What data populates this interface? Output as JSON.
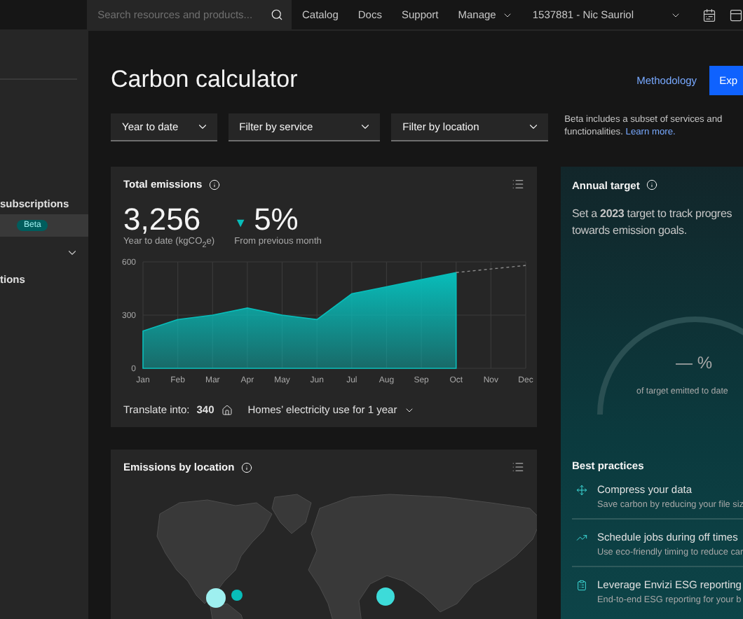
{
  "header": {
    "search": {
      "placeholder": "Search resources and products..."
    },
    "nav": [
      {
        "label": "Catalog",
        "dropdown": false
      },
      {
        "label": "Docs",
        "dropdown": false
      },
      {
        "label": "Support",
        "dropdown": false
      },
      {
        "label": "Manage",
        "dropdown": true
      },
      {
        "label": "1537881 - Nic Sauriol",
        "dropdown": true
      }
    ]
  },
  "sidebar": {
    "items": [
      {
        "kind": "heading",
        "label": "subscriptions",
        "selected": false
      },
      {
        "kind": "item",
        "badge": "Beta",
        "selected": true
      },
      {
        "kind": "group",
        "expanded": false,
        "selected": false
      },
      {
        "kind": "heading",
        "label": "tions",
        "selected": false
      }
    ]
  },
  "page": {
    "title": "Carbon calculator",
    "link": "Methodology",
    "button": "Exp"
  },
  "filters": [
    {
      "label": "Year to date"
    },
    {
      "label": "Filter by service"
    },
    {
      "label": "Filter by location"
    }
  ],
  "beta_note": {
    "text": "Beta includes a subset of services and functionalities.",
    "link": "Learn more."
  },
  "total_emissions": {
    "title": "Total emissions",
    "total": "3,256",
    "total_caption": "Year to date (kgCO$_{2}$e)",
    "change": "5%",
    "change_icon": "▼",
    "change_caption": "From previous month",
    "chart_data": {
      "type": "area",
      "categories": [
        "Jan",
        "Feb",
        "Mar",
        "Apr",
        "May",
        "Jun",
        "Jul",
        "Aug",
        "Sep",
        "Oct",
        "Nov",
        "Dec"
      ],
      "series": [
        {
          "type": "area",
          "color": "#08bdba",
          "values": [
            210,
            275,
            300,
            340,
            300,
            275,
            420,
            460,
            500,
            540,
            null,
            null
          ]
        },
        {
          "type": "line",
          "line_style": "dashed",
          "color": "#8d8d8d",
          "values": [
            null,
            null,
            null,
            null,
            null,
            null,
            null,
            null,
            null,
            540,
            560,
            580
          ]
        }
      ],
      "ylim": [
        0,
        600
      ],
      "yticks": [
        0,
        300,
        600
      ],
      "grid": true
    },
    "translate": {
      "label": "Translate into:",
      "value": "340",
      "unit": "Homes’ electricity use for 1 year"
    }
  },
  "annual_target": {
    "title": "Annual target",
    "text": "Set a **2023** target to track progres\ntowards emission goals.",
    "gauge_value": "— %",
    "gauge_caption": "of target emitted to date"
  },
  "best_practices": {
    "title": "Best practices",
    "items": [
      {
        "kind": "compress",
        "title": "Compress your data",
        "description": "Save carbon by reducing your file siz"
      },
      {
        "kind": "schedule",
        "title": "Schedule jobs during off times",
        "description": "Use eco-friendly timing to reduce car"
      },
      {
        "kind": "report",
        "title": "Leverage Envizi ESG reporting",
        "description": "End-to-end ESG reporting for your b"
      }
    ]
  },
  "location": {
    "title": "Emissions by location"
  }
}
